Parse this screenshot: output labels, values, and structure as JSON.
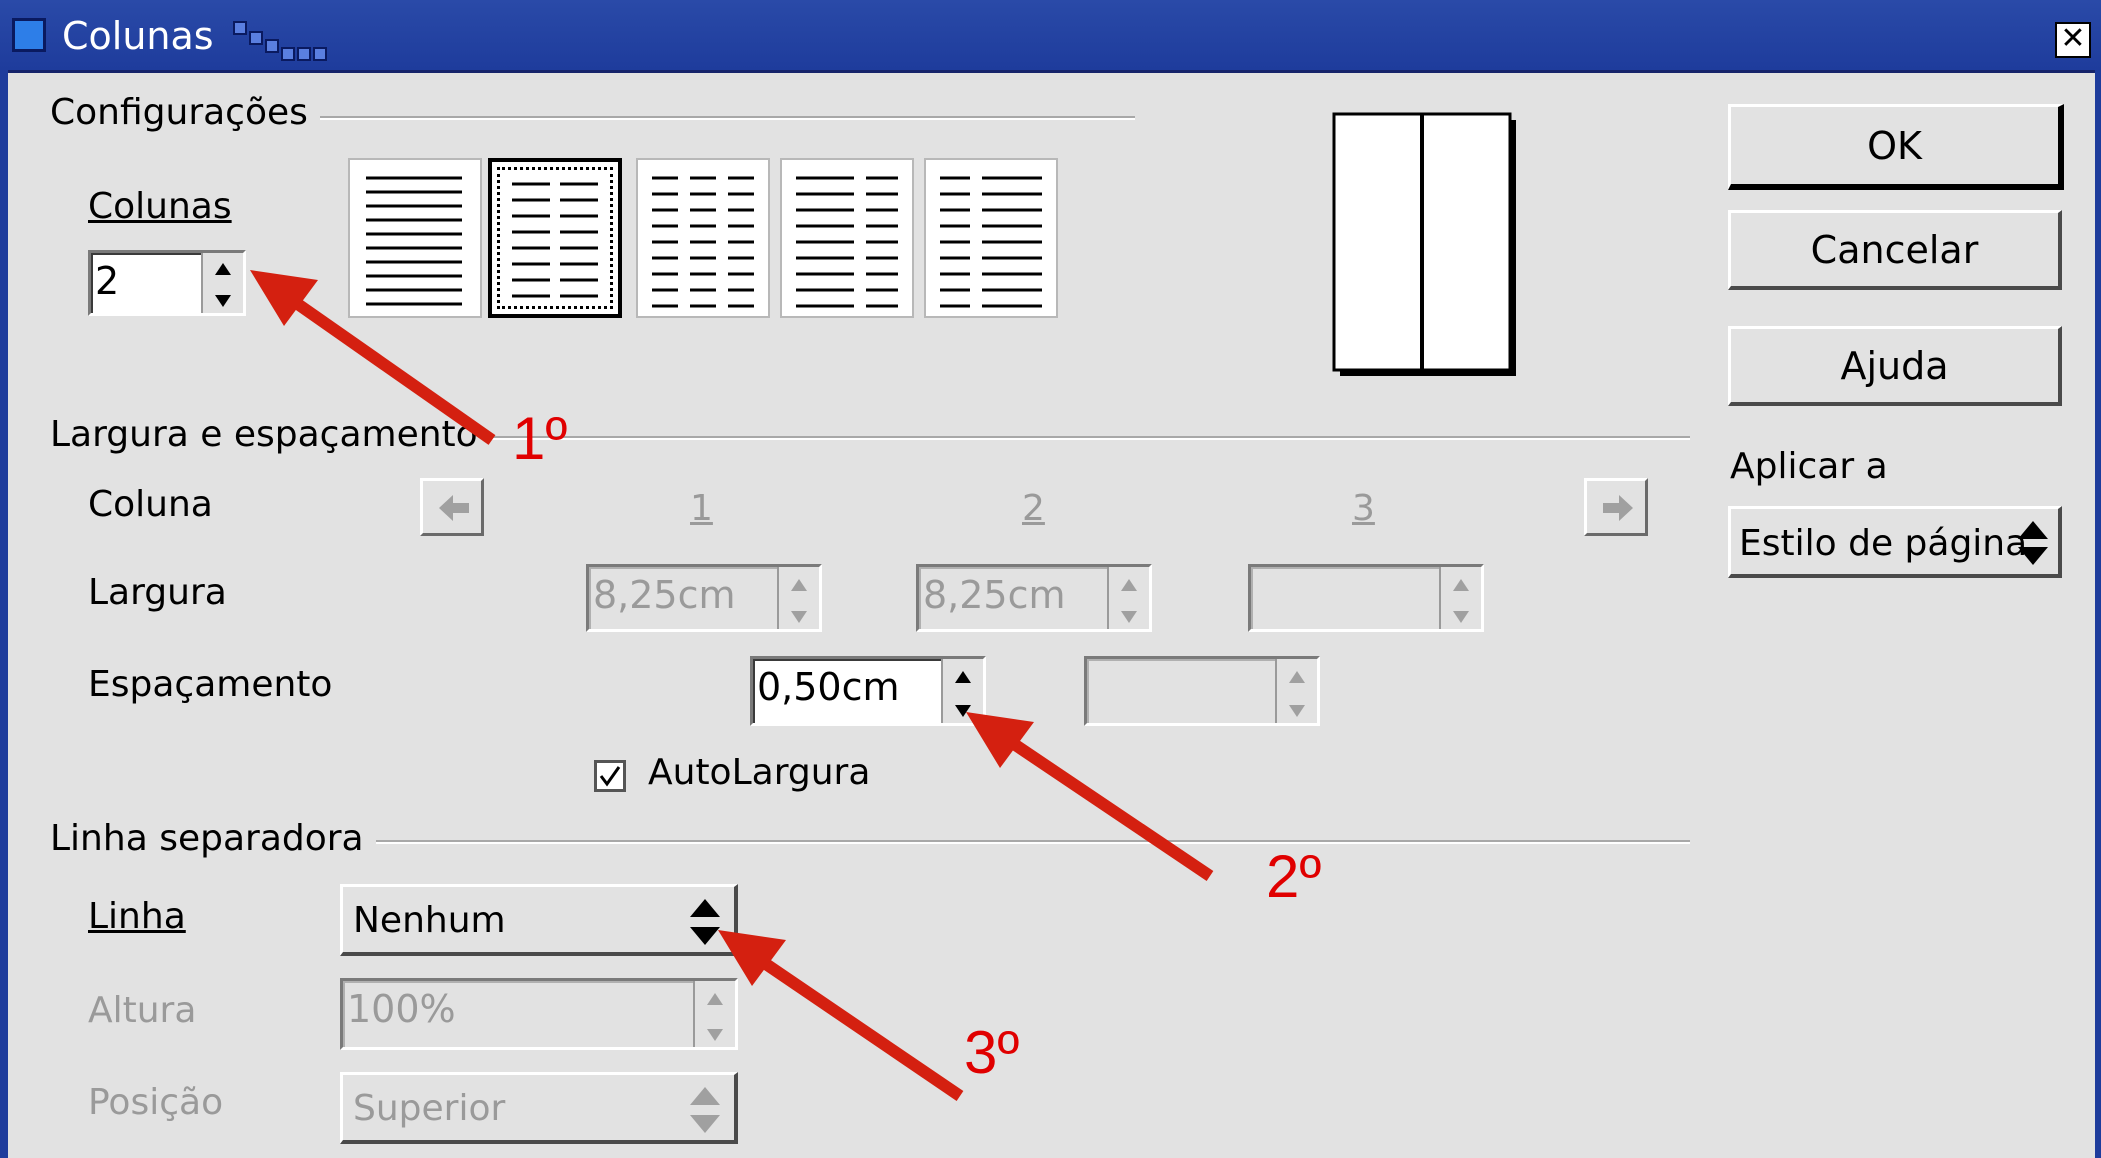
{
  "window": {
    "title": "Colunas",
    "close_icon": "close-icon"
  },
  "sections": {
    "config": "Configurações",
    "width_spacing": "Largura e espaçamento",
    "separator": "Linha separadora"
  },
  "config": {
    "columns_label": "Colunas",
    "columns_value": "2",
    "preset_count": 5,
    "selected_preset": 2
  },
  "width_spacing": {
    "column_label": "Coluna",
    "column_numbers": [
      "1",
      "2",
      "3"
    ],
    "width_label": "Largura",
    "width_values": [
      "8,25cm",
      "8,25cm",
      ""
    ],
    "spacing_label": "Espaçamento",
    "spacing_values": [
      "0,50cm",
      ""
    ],
    "autowidth_label": "AutoLargura",
    "autowidth_checked": true
  },
  "separator": {
    "line_label": "Linha",
    "line_value": "Nenhum",
    "height_label": "Altura",
    "height_value": "100%",
    "position_label": "Posição",
    "position_value": "Superior"
  },
  "buttons": {
    "ok": "OK",
    "cancel": "Cancelar",
    "help": "Ajuda"
  },
  "apply_to": {
    "label": "Aplicar a",
    "value": "Estilo de página"
  },
  "annotations": [
    "1º",
    "2º",
    "3º"
  ],
  "colors": {
    "annotation": "#e00000",
    "titlebar": "#1e3c9c"
  }
}
